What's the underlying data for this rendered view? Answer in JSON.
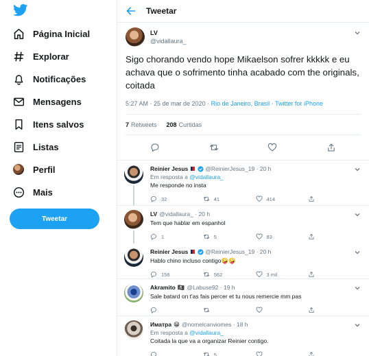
{
  "sidebar": {
    "logo_icon": "twitter-bird-icon",
    "items": [
      {
        "label": "Página Inicial",
        "icon": "home-icon"
      },
      {
        "label": "Explorar",
        "icon": "hashtag-icon"
      },
      {
        "label": "Notificações",
        "icon": "bell-icon"
      },
      {
        "label": "Mensagens",
        "icon": "envelope-icon"
      },
      {
        "label": "Itens salvos",
        "icon": "bookmark-icon"
      },
      {
        "label": "Listas",
        "icon": "list-icon"
      },
      {
        "label": "Perfil",
        "icon": "profile-avatar"
      },
      {
        "label": "Mais",
        "icon": "more-circle-icon"
      }
    ],
    "tweet_button": "Tweetar"
  },
  "header": {
    "title": "Tweetar"
  },
  "focus_tweet": {
    "name": "LV",
    "handle": "@vidallaura_",
    "text": "Sigo chorando vendo hope Mikaelson sofrer kkkkk e eu achava que o sofrimento tinha acabado com the originals, coitada",
    "time": "5:27 AM · 25 de mar de 2020 · ",
    "location": "Rio de Janeiro, Brasil",
    "sep": " · ",
    "source": "Twitter for iPhone",
    "retweets_count": "7",
    "retweets_label": "Retweets",
    "likes_count": "208",
    "likes_label": "Curtidas"
  },
  "replies": [
    {
      "name": "Reinier Jesus",
      "handle": "@ReinierJesus_19",
      "time": "· 20 h",
      "reply_prefix": "Em resposta a ",
      "reply_to": "@vidallaura_",
      "text": "Me responde no insta",
      "replies": "32",
      "retweets": "41",
      "likes": "414"
    },
    {
      "name": "LV",
      "handle": "@vidallaura_",
      "time": "· 20 h",
      "text": "Tem que hablar em espanhol",
      "replies": "1",
      "retweets": "5",
      "likes": "83"
    },
    {
      "name": "Reinier Jesus",
      "handle": "@ReinierJesus_19",
      "time": "· 20 h",
      "text": "Hablo chino incluso contigo🤪🤪",
      "replies": "156",
      "retweets": "562",
      "likes": "3 mil"
    },
    {
      "name": "Akramito",
      "name_emoji": "🏴‍☠️",
      "handle": "@Labuse92",
      "time": "· 19 h",
      "text": "Sale batard on t'as fais percer et tu nous remercie mm pas",
      "replies": "",
      "retweets": "",
      "likes": ""
    },
    {
      "name": "Иматра",
      "name_emoji": "😁",
      "handle": "@nomelcanviomes",
      "time": "· 18 h",
      "reply_prefix": "Em resposta a ",
      "reply_to": "@vidallaura_",
      "text": "Coitada la que va a organizar Reinier contigo.",
      "replies": "",
      "retweets": "5",
      "likes": ""
    }
  ],
  "colors": {
    "accent": "#1da1f2",
    "text": "#14171a",
    "muted": "#657786",
    "border": "#e6ecf0",
    "verified": "#1da1f2"
  }
}
